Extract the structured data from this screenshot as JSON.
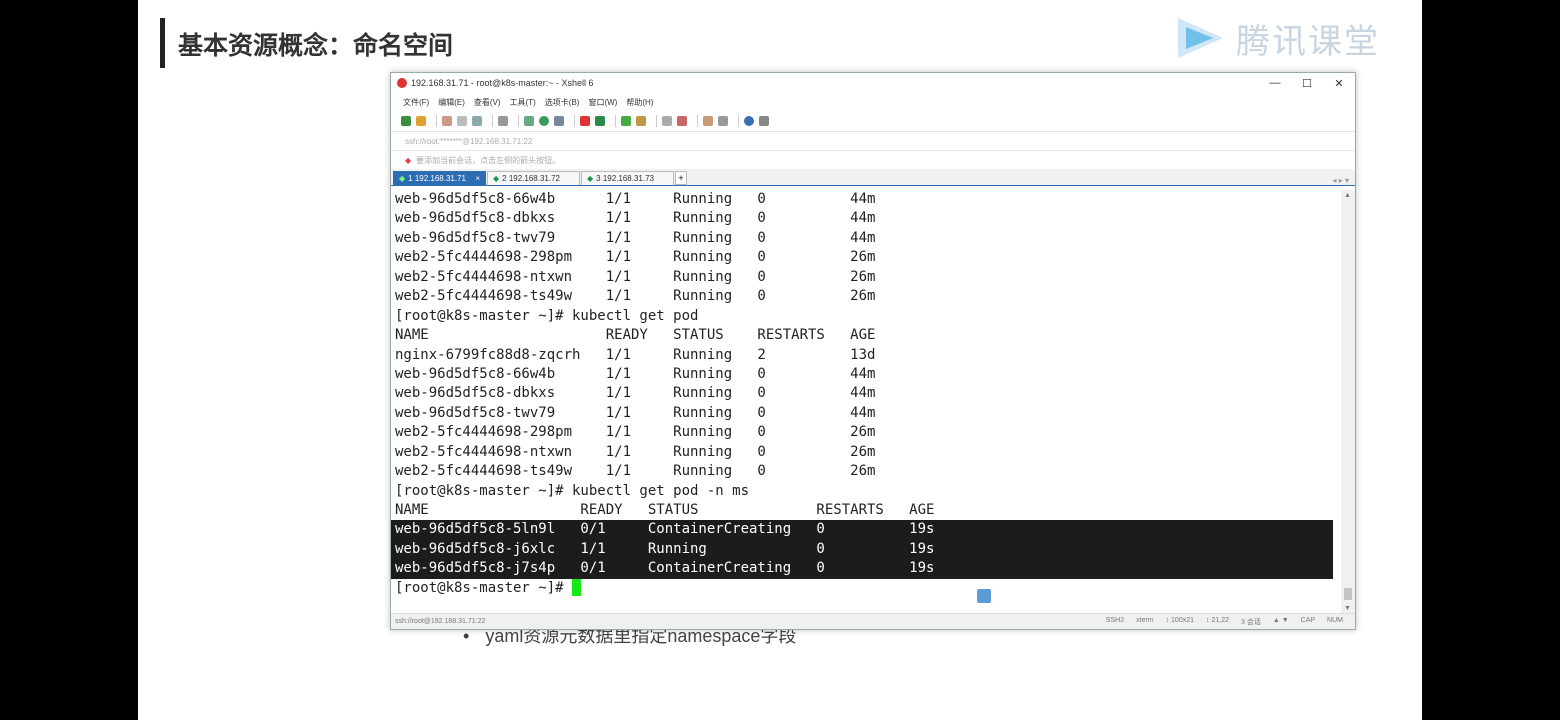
{
  "slide": {
    "title": "基本资源概念：命名空间",
    "logo_text": "腾讯课堂",
    "bullet_text": "yaml资源元数据里指定namespace字段"
  },
  "window": {
    "title": "192.168.31.71 - root@k8s-master:~ - Xshell 6",
    "controls": [
      "—",
      "☐",
      "✕"
    ]
  },
  "menu": [
    "文件(F)",
    "编辑(E)",
    "查看(V)",
    "工具(T)",
    "选项卡(B)",
    "窗口(W)",
    "帮助(H)"
  ],
  "address_bar": "ssh://root:*******@192.168.31.71:22",
  "hint_bar": "要添加当前会话，点击左侧的箭头按钮。",
  "tabs": [
    {
      "label": "1 192.168.31.71",
      "active": true
    },
    {
      "label": "2 192.168.31.72",
      "active": false
    },
    {
      "label": "3 192.168.31.73",
      "active": false
    }
  ],
  "terminal": {
    "lines": [
      "web-96d5df5c8-66w4b      1/1     Running   0          44m",
      "web-96d5df5c8-dbkxs      1/1     Running   0          44m",
      "web-96d5df5c8-twv79      1/1     Running   0          44m",
      "web2-5fc4444698-298pm    1/1     Running   0          26m",
      "web2-5fc4444698-ntxwn    1/1     Running   0          26m",
      "web2-5fc4444698-ts49w    1/1     Running   0          26m",
      "[root@k8s-master ~]# kubectl get pod",
      "NAME                     READY   STATUS    RESTARTS   AGE",
      "nginx-6799fc88d8-zqcrh   1/1     Running   2          13d",
      "web-96d5df5c8-66w4b      1/1     Running   0          44m",
      "web-96d5df5c8-dbkxs      1/1     Running   0          44m",
      "web-96d5df5c8-twv79      1/1     Running   0          44m",
      "web2-5fc4444698-298pm    1/1     Running   0          26m",
      "web2-5fc4444698-ntxwn    1/1     Running   0          26m",
      "web2-5fc4444698-ts49w    1/1     Running   0          26m",
      "[root@k8s-master ~]# kubectl get pod -n ms",
      "NAME                  READY   STATUS              RESTARTS   AGE"
    ],
    "highlighted_lines": [
      "web-96d5df5c8-5ln9l   0/1     ContainerCreating   0          19s",
      "web-96d5df5c8-j6xlc   1/1     Running             0          19s",
      "web-96d5df5c8-j7s4p   0/1     ContainerCreating   0          19s"
    ],
    "prompt": "[root@k8s-master ~]# "
  },
  "status_bar": {
    "left": "ssh://root@192.168.31.71:22",
    "right": [
      "SSH2",
      "xterm",
      "↕ 100x21",
      "↕ 21,22",
      "3 会话",
      "▲ ▼",
      "CAP",
      "NUM"
    ]
  }
}
